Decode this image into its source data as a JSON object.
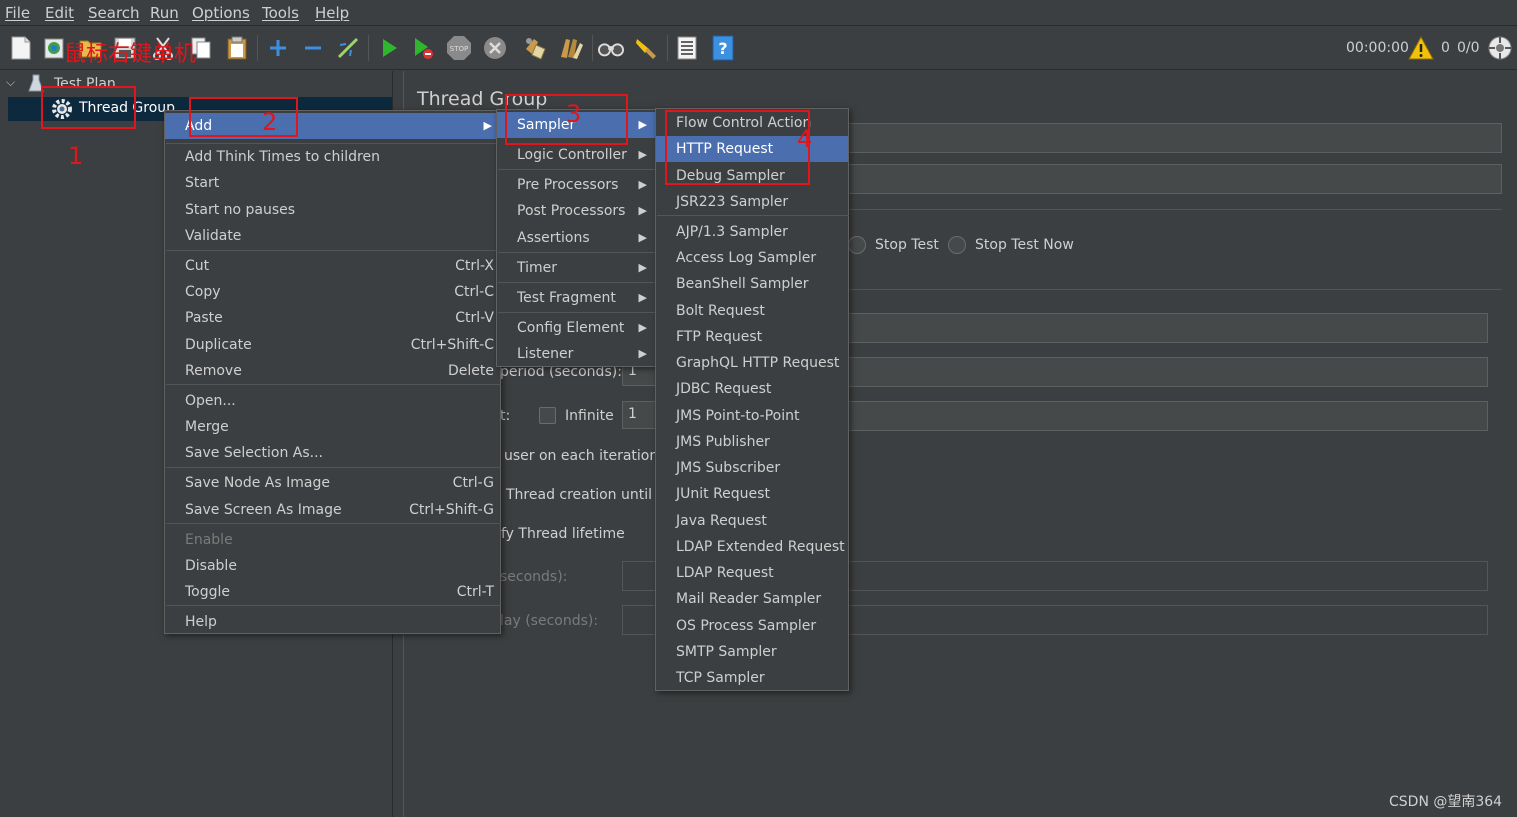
{
  "menubar": {
    "items": [
      "File",
      "Edit",
      "Search",
      "Run",
      "Options",
      "Tools",
      "Help"
    ]
  },
  "toolbar": {
    "timer": "00:00:00",
    "warning_count": "0",
    "threads": "0/0",
    "icons": [
      "new-icon",
      "templates-icon",
      "open-icon",
      "save-icon",
      "cut-icon",
      "copy-icon",
      "paste-icon",
      "expand-icon",
      "collapse-icon",
      "toggle-icon",
      "start-icon",
      "start-no-pauses-icon",
      "stop-icon",
      "shutdown-icon",
      "clear-icon",
      "clear-all-icon",
      "search-icon",
      "reset-search-icon",
      "function-helper-icon",
      "help-icon",
      "warning-icon",
      "remote-icon"
    ]
  },
  "tree": {
    "root": "Test Plan",
    "child": "Thread Group"
  },
  "main": {
    "title": "Thread Group",
    "stop_test": "Stop Test",
    "stop_test_now": "Stop Test Now",
    "ramp_up_label": "period (seconds):",
    "ramp_up_value": "1",
    "loop_label": "t:",
    "infinite_label": "Infinite",
    "loop_value": "1",
    "same_user_label": "user on each iteration",
    "delay_label": "Thread creation until n",
    "lifetime_label": "fy Thread lifetime",
    "duration_label": "seconds):",
    "startup_delay_label": "lay (seconds):"
  },
  "context_menu": {
    "items": [
      {
        "label": "Add",
        "shortcut": "",
        "submenu": true,
        "selected": true
      },
      {
        "label": "Add Think Times to children",
        "shortcut": ""
      },
      {
        "label": "Start",
        "shortcut": ""
      },
      {
        "label": "Start no pauses",
        "shortcut": ""
      },
      {
        "label": "Validate",
        "shortcut": ""
      },
      {
        "label": "Cut",
        "shortcut": "Ctrl-X"
      },
      {
        "label": "Copy",
        "shortcut": "Ctrl-C"
      },
      {
        "label": "Paste",
        "shortcut": "Ctrl-V"
      },
      {
        "label": "Duplicate",
        "shortcut": "Ctrl+Shift-C"
      },
      {
        "label": "Remove",
        "shortcut": "Delete"
      },
      {
        "label": "Open...",
        "shortcut": ""
      },
      {
        "label": "Merge",
        "shortcut": ""
      },
      {
        "label": "Save Selection As...",
        "shortcut": ""
      },
      {
        "label": "Save Node As Image",
        "shortcut": "Ctrl-G"
      },
      {
        "label": "Save Screen As Image",
        "shortcut": "Ctrl+Shift-G"
      },
      {
        "label": "Enable",
        "shortcut": "",
        "disabled": true
      },
      {
        "label": "Disable",
        "shortcut": ""
      },
      {
        "label": "Toggle",
        "shortcut": "Ctrl-T"
      },
      {
        "label": "Help",
        "shortcut": ""
      }
    ]
  },
  "add_menu": {
    "items": [
      {
        "label": "Sampler",
        "selected": true
      },
      {
        "label": "Logic Controller"
      },
      {
        "label": "Pre Processors"
      },
      {
        "label": "Post Processors"
      },
      {
        "label": "Assertions"
      },
      {
        "label": "Timer"
      },
      {
        "label": "Test Fragment"
      },
      {
        "label": "Config Element"
      },
      {
        "label": "Listener"
      }
    ]
  },
  "sampler_menu": {
    "items": [
      {
        "label": "Flow Control Action"
      },
      {
        "label": "HTTP Request",
        "selected": true
      },
      {
        "label": "Debug Sampler"
      },
      {
        "label": "JSR223 Sampler"
      },
      {
        "label": "AJP/1.3 Sampler"
      },
      {
        "label": "Access Log Sampler"
      },
      {
        "label": "BeanShell Sampler"
      },
      {
        "label": "Bolt Request"
      },
      {
        "label": "FTP Request"
      },
      {
        "label": "GraphQL HTTP Request"
      },
      {
        "label": "JDBC Request"
      },
      {
        "label": "JMS Point-to-Point"
      },
      {
        "label": "JMS Publisher"
      },
      {
        "label": "JMS Subscriber"
      },
      {
        "label": "JUnit Request"
      },
      {
        "label": "Java Request"
      },
      {
        "label": "LDAP Extended Request"
      },
      {
        "label": "LDAP Request"
      },
      {
        "label": "Mail Reader Sampler"
      },
      {
        "label": "OS Process Sampler"
      },
      {
        "label": "SMTP Sampler"
      },
      {
        "label": "TCP Sampler"
      }
    ]
  },
  "annotations": {
    "note": "鼠标右键单机",
    "step1": "1",
    "step2": "2",
    "step3": "3",
    "step4": "4"
  },
  "watermark": "CSDN @望南364",
  "colors": {
    "background": "#3c3f41",
    "selection": "#4b6eaf",
    "annotation_red": "#e0161d",
    "start_green": "#2fb62f",
    "help_blue": "#3d8fe0",
    "warning_yellow": "#f2c10b"
  }
}
